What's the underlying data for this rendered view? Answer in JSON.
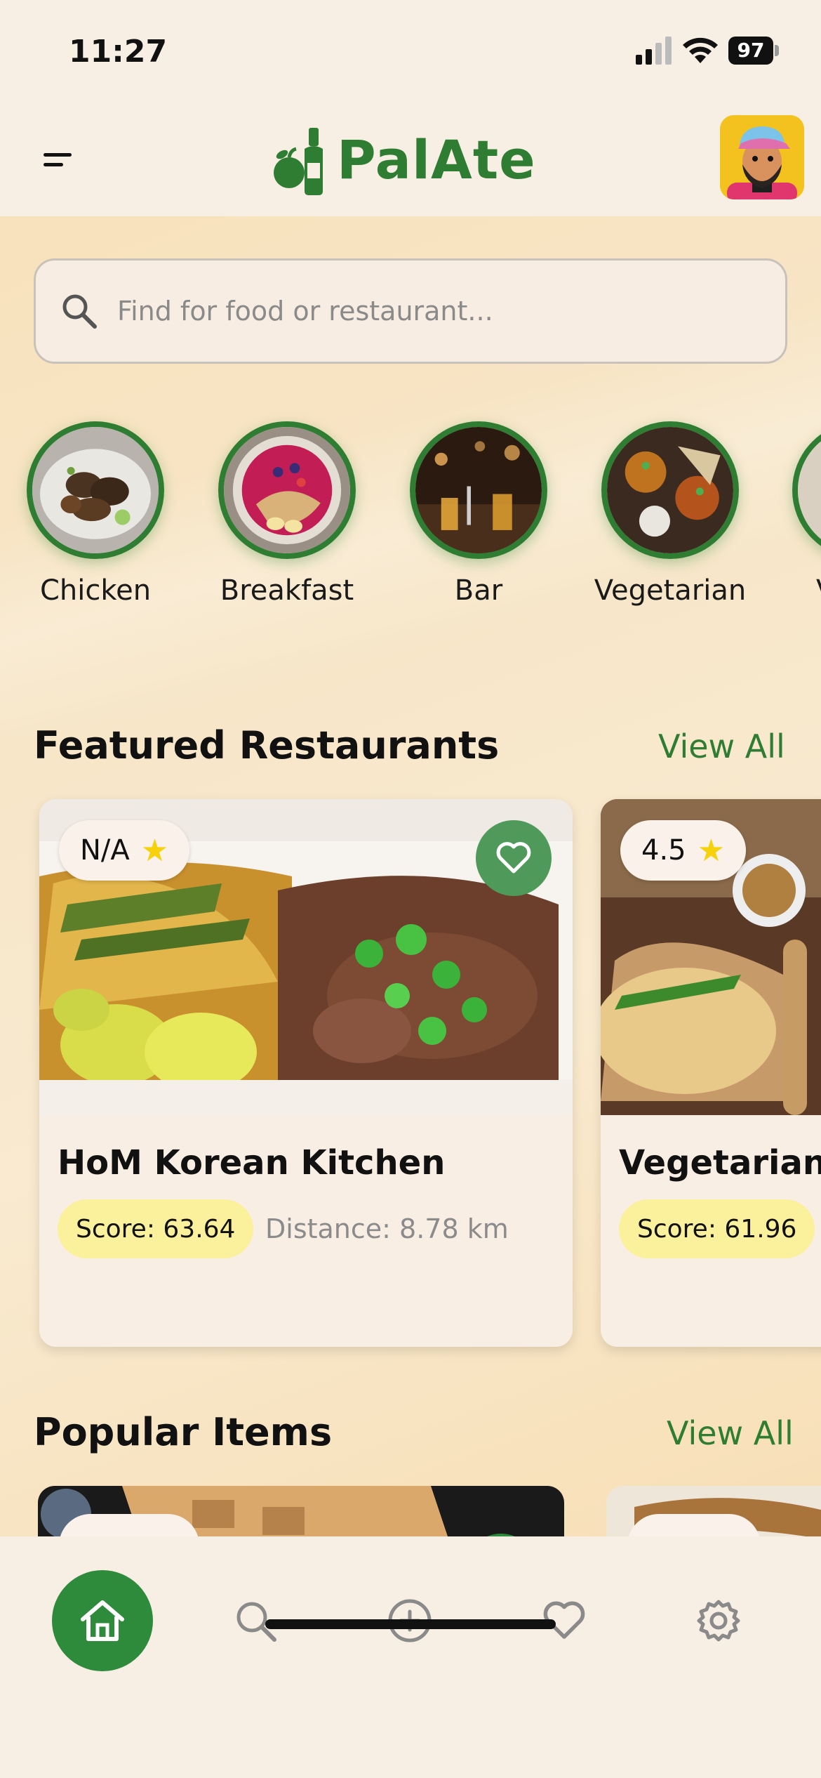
{
  "status_bar": {
    "time": "11:27",
    "battery": "97"
  },
  "header": {
    "app_name": "PalAte"
  },
  "search": {
    "placeholder": "Find for food or restaurant..."
  },
  "categories": [
    {
      "label": "Chicken"
    },
    {
      "label": "Breakfast"
    },
    {
      "label": "Bar"
    },
    {
      "label": "Vegetarian"
    },
    {
      "label": "V"
    }
  ],
  "featured": {
    "title": "Featured Restaurants",
    "view_all": "View All",
    "cards": [
      {
        "rating": "N/A",
        "name": "HoM Korean Kitchen",
        "score": "Score: 63.64",
        "distance": "Distance: 8.78 km"
      },
      {
        "rating": "4.5",
        "name": "Vegetarian H",
        "score": "Score: 61.96",
        "distance": ""
      }
    ]
  },
  "popular": {
    "title": "Popular Items",
    "view_all": "View All"
  },
  "colors": {
    "brand_green": "#2E7D32",
    "score_yellow": "#FBF09C",
    "star": "#F5D20B"
  },
  "nav": {
    "items": [
      {
        "icon": "home-icon",
        "active": true
      },
      {
        "icon": "search-icon",
        "active": false
      },
      {
        "icon": "add-icon",
        "active": false
      },
      {
        "icon": "heart-icon",
        "active": false
      },
      {
        "icon": "settings-icon",
        "active": false
      }
    ]
  }
}
